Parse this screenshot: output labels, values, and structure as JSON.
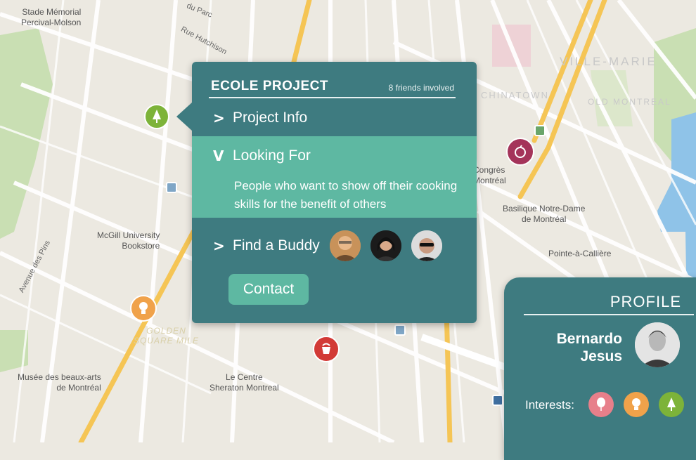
{
  "map": {
    "labels": {
      "stade": "Stade Mémorial\nPercival-Molson",
      "mcgill": "McGill University\nBookstore",
      "musee": "Musée des beaux-arts\nde Montréal",
      "centre": "Le Centre\nSheraton Montreal",
      "basilique": "Basilique Notre-Dame\nde Montréal",
      "pointe": "Pointe-à-Callière",
      "congres": "Congrès\nMontréal",
      "ville_marie": "VILLE-MARIE",
      "chinatown": "CHINATOWN",
      "old_montreal": "OLD MONTREAL",
      "golden": "GOLDEN\nSQUARE MILE",
      "montreal_faint": "Montréal",
      "avenue_des_pins": "Avenue des Pins",
      "rue_hutchison": "Rue Hutchison",
      "du_parc": "du Parc"
    },
    "colors": {
      "land": "#ece9e1",
      "park": "#c9dfb3",
      "road": "#ffffff",
      "highway": "#f5c555",
      "water": "#8fc3e8"
    }
  },
  "popup": {
    "title": "ECOLE PROJECT",
    "friends_count": "8 friends involved",
    "project_info_label": "Project Info",
    "looking_for_label": "Looking For",
    "looking_for_desc": "People who want to show off their cooking skills for the benefit of others",
    "find_buddy_label": "Find a Buddy",
    "contact_label": "Contact",
    "chevron_right": ">",
    "chevron_down": "V",
    "colors": {
      "panel": "#3e7b80",
      "accent": "#5eb8a2"
    }
  },
  "profile": {
    "title": "PROFILE",
    "name": "Bernardo\nJesus",
    "interests_label": "Interests:",
    "interest_icons": [
      "balloon-icon",
      "lightbulb-icon",
      "tree-icon"
    ],
    "interest_colors": [
      "#e77f8a",
      "#f0a24a",
      "#7db339"
    ]
  }
}
